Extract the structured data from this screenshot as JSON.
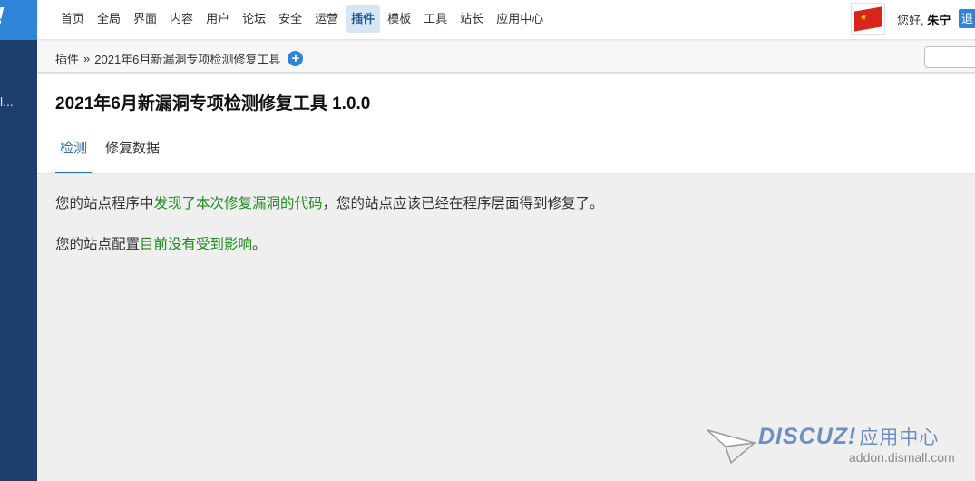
{
  "sidebar": {
    "logo_text": "!",
    "item_label": "l..."
  },
  "topnav": {
    "menu": [
      {
        "label": "首页"
      },
      {
        "label": "全局"
      },
      {
        "label": "界面"
      },
      {
        "label": "内容"
      },
      {
        "label": "用户"
      },
      {
        "label": "论坛"
      },
      {
        "label": "安全"
      },
      {
        "label": "运营"
      },
      {
        "label": "插件",
        "active": true
      },
      {
        "label": "模板"
      },
      {
        "label": "工具"
      },
      {
        "label": "站长"
      },
      {
        "label": "应用中心"
      }
    ],
    "greeting": "您好,",
    "username": "朱宁",
    "logout_label": "退"
  },
  "breadcrumb": {
    "parent": "插件",
    "separator": "»",
    "current": "2021年6月新漏洞专项检测修复工具",
    "add_icon": "+"
  },
  "search": {
    "value": ""
  },
  "page": {
    "title": "2021年6月新漏洞专项检测修复工具 1.0.0",
    "tabs": [
      {
        "label": "检测",
        "active": true
      },
      {
        "label": "修复数据"
      }
    ]
  },
  "content": {
    "line1": {
      "prefix": "您的站点程序中",
      "highlight": "发现了本次修复漏洞的代码",
      "suffix": "，您的站点应该已经在程序层面得到修复了。"
    },
    "line2": {
      "prefix": "您的站点配置",
      "highlight": "目前没有受到影响",
      "suffix": "。"
    }
  },
  "watermark": {
    "brand": "DISCUZ!",
    "brand_cn": "应用中心",
    "url": "addon.dismall.com"
  },
  "colors": {
    "sidebar": "#1d3f6e",
    "accent": "#2f84d8",
    "highlight_green": "#1f8a1f",
    "active_tab": "#2f6fb0"
  }
}
